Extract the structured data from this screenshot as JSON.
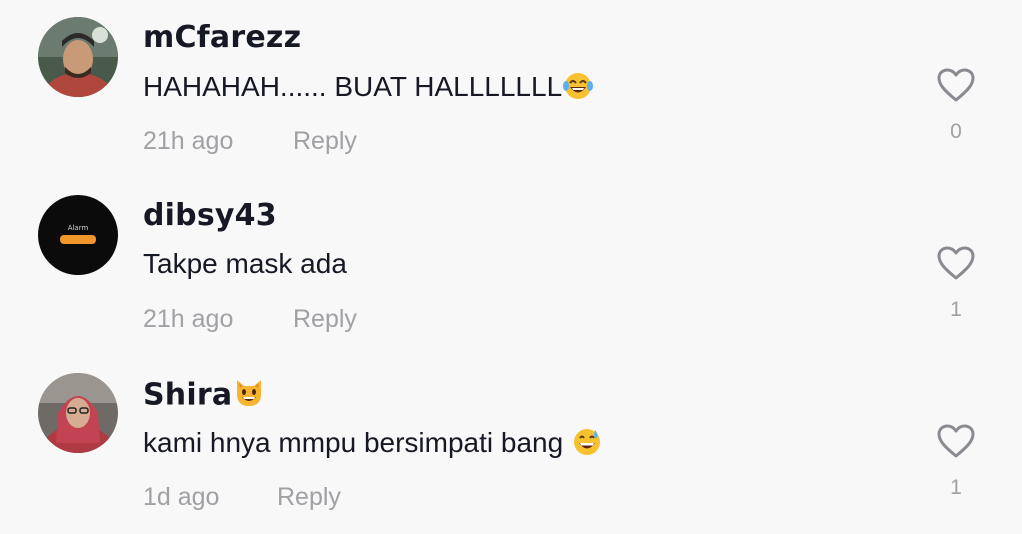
{
  "comments": [
    {
      "username": "mCfarezz",
      "text": "HAHAHAH...... BUAT HALLLLLLL",
      "text_emoji": "face-with-tears-of-joy",
      "time": "21h ago",
      "reply_label": "Reply",
      "likes": "0",
      "avatar": "photo-man-in-cap-with-beard"
    },
    {
      "username": "dibsy43",
      "text": "Takpe mask ada",
      "time": "21h ago",
      "reply_label": "Reply",
      "likes": "1",
      "avatar": "phone-alarm-screen",
      "avatar_text": "Alarm"
    },
    {
      "username": "Shira",
      "username_emoji": "grinning-cat-face",
      "text": "kami hnya mmpu bersimpati bang",
      "text_emoji": "grinning-face-with-sweat",
      "time": "1d ago",
      "reply_label": "Reply",
      "likes": "1",
      "avatar": "photo-woman-in-hijab-with-glasses"
    }
  ],
  "colors": {
    "background": "#f8f8f8",
    "primary_text": "#161823",
    "secondary_text": "#a0a0a5"
  }
}
